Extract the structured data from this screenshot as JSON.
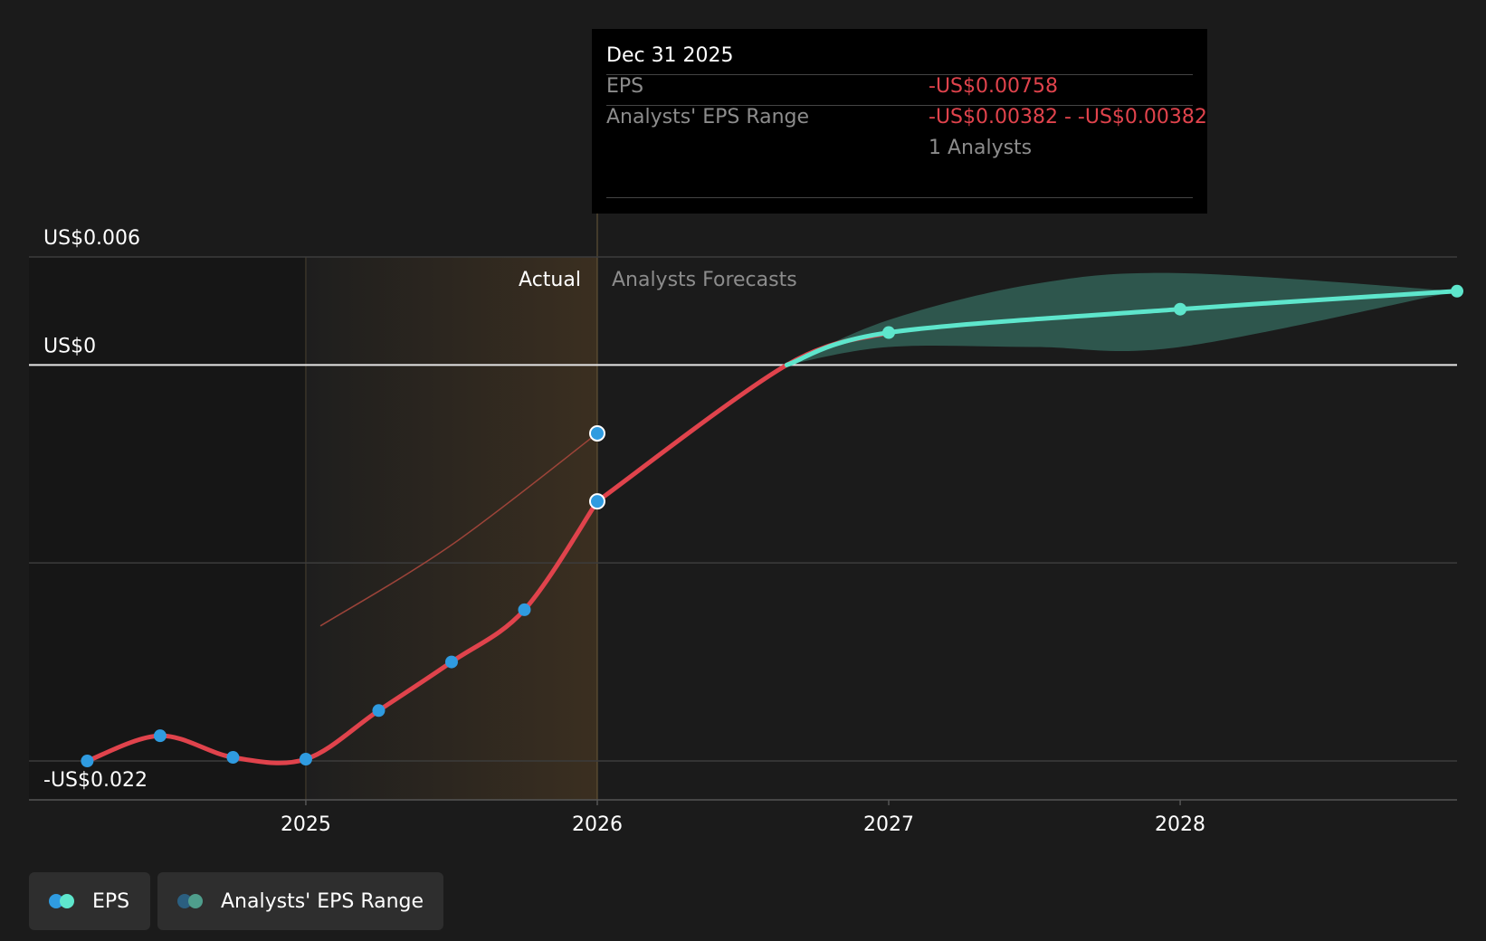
{
  "colors": {
    "background": "#1b1b1b",
    "eps_actual_line": "#e0434c",
    "eps_forecast_line": "#5ee6cc",
    "actual_point": "#2f9be0",
    "forecast_point": "#5ee6cc",
    "range_fill": "#2f5a50",
    "actual_shade": "#3a2f20"
  },
  "tooltip": {
    "date": "Dec 31 2025",
    "eps_label": "EPS",
    "eps_value": "-US$0.00758",
    "range_label": "Analysts' EPS Range",
    "range_value": "-US$0.00382 - -US$0.00382",
    "analysts_count": "1 Analysts"
  },
  "legend": {
    "items": [
      {
        "label": "EPS",
        "icon": "eps-dots-icon"
      },
      {
        "label": "Analysts' EPS Range",
        "icon": "range-dots-icon"
      }
    ]
  },
  "chart_data": {
    "type": "line",
    "y_tick_labels": [
      "US$0.006",
      "US$0",
      "-US$0.022"
    ],
    "y_ticks": [
      0.006,
      0,
      -0.022
    ],
    "ylim": [
      -0.022,
      0.006
    ],
    "x_tick_labels": [
      "2025",
      "2026",
      "2027",
      "2028"
    ],
    "x_ticks": [
      2025,
      2026,
      2027,
      2028
    ],
    "xlim": [
      2024.05,
      2028.95
    ],
    "region_labels": {
      "actual": "Actual",
      "forecast": "Analysts Forecasts"
    },
    "actual_region": [
      2025,
      2026
    ],
    "grid": true,
    "legend_position": "bottom-left",
    "series": [
      {
        "name": "EPS",
        "kind": "actual",
        "points": [
          {
            "x": 2024.25,
            "y": -0.022
          },
          {
            "x": 2024.5,
            "y": -0.0206
          },
          {
            "x": 2024.75,
            "y": -0.0218
          },
          {
            "x": 2025.0,
            "y": -0.0219
          },
          {
            "x": 2025.25,
            "y": -0.0192
          },
          {
            "x": 2025.5,
            "y": -0.0165
          },
          {
            "x": 2025.75,
            "y": -0.0136
          },
          {
            "x": 2026.0,
            "y": -0.00758
          }
        ]
      },
      {
        "name": "EPS",
        "kind": "forecast",
        "points": [
          {
            "x": 2026.0,
            "y": -0.00758
          },
          {
            "x": 2026.65,
            "y": 0.0
          },
          {
            "x": 2027.0,
            "y": 0.0018
          },
          {
            "x": 2028.0,
            "y": 0.0031
          },
          {
            "x": 2028.95,
            "y": 0.0041
          }
        ]
      },
      {
        "name": "Analysts' EPS Range",
        "kind": "range",
        "upper": [
          {
            "x": 2026.65,
            "y": 0.0
          },
          {
            "x": 2027.0,
            "y": 0.0025
          },
          {
            "x": 2027.5,
            "y": 0.0045
          },
          {
            "x": 2028.0,
            "y": 0.0051
          },
          {
            "x": 2028.95,
            "y": 0.0041
          }
        ],
        "lower": [
          {
            "x": 2026.65,
            "y": 0.0
          },
          {
            "x": 2027.0,
            "y": 0.001
          },
          {
            "x": 2027.5,
            "y": 0.001
          },
          {
            "x": 2028.0,
            "y": 0.001
          },
          {
            "x": 2028.95,
            "y": 0.0041
          }
        ]
      },
      {
        "name": "",
        "kind": "prior-estimate",
        "points": [
          {
            "x": 2025.05,
            "y": -0.0145
          },
          {
            "x": 2025.5,
            "y": -0.01
          },
          {
            "x": 2026.0,
            "y": -0.0038
          }
        ]
      }
    ]
  }
}
